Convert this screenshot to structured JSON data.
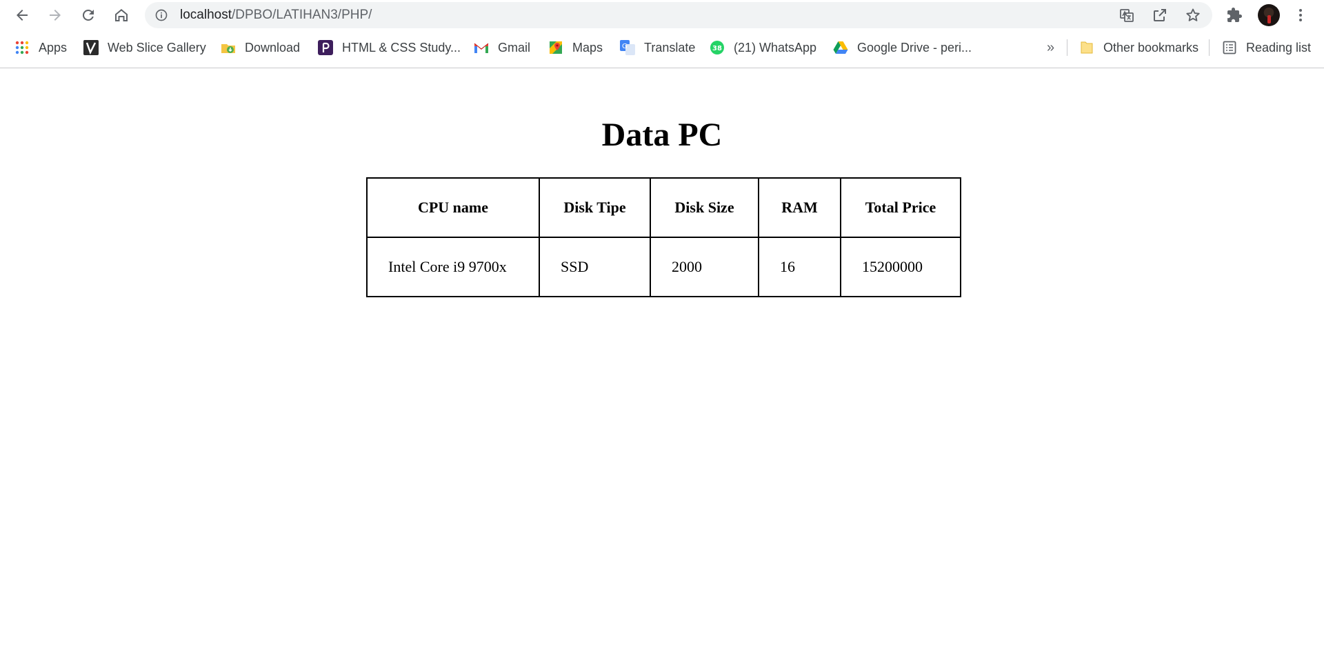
{
  "browser": {
    "url_host": "localhost",
    "url_path": "/DPBO/LATIHAN3/PHP/",
    "bookmarks": [
      {
        "label": "Apps",
        "icon": "apps-grid-icon"
      },
      {
        "label": "Web Slice Gallery",
        "icon": "web-slice-icon"
      },
      {
        "label": "Download",
        "icon": "download-icon"
      },
      {
        "label": "HTML & CSS Study...",
        "icon": "study-icon"
      },
      {
        "label": "Gmail",
        "icon": "gmail-icon"
      },
      {
        "label": "Maps",
        "icon": "maps-icon"
      },
      {
        "label": "Translate",
        "icon": "translate-icon"
      },
      {
        "label": "(21) WhatsApp",
        "icon": "whatsapp-icon",
        "badge": "38"
      },
      {
        "label": "Google Drive - peri...",
        "icon": "drive-icon"
      }
    ],
    "overflow_label": "»",
    "other_bookmarks": "Other bookmarks",
    "reading_list": "Reading list"
  },
  "page": {
    "title": "Data PC",
    "table": {
      "headers": [
        "CPU name",
        "Disk Tipe",
        "Disk Size",
        "RAM",
        "Total Price"
      ],
      "rows": [
        [
          "Intel Core i9 9700x",
          "SSD",
          "2000",
          "16",
          "15200000"
        ]
      ]
    }
  },
  "colors": {
    "toolbar_icon": "#5f6368",
    "omnibox_bg": "#f1f3f4",
    "divider": "#c8c9cc"
  }
}
